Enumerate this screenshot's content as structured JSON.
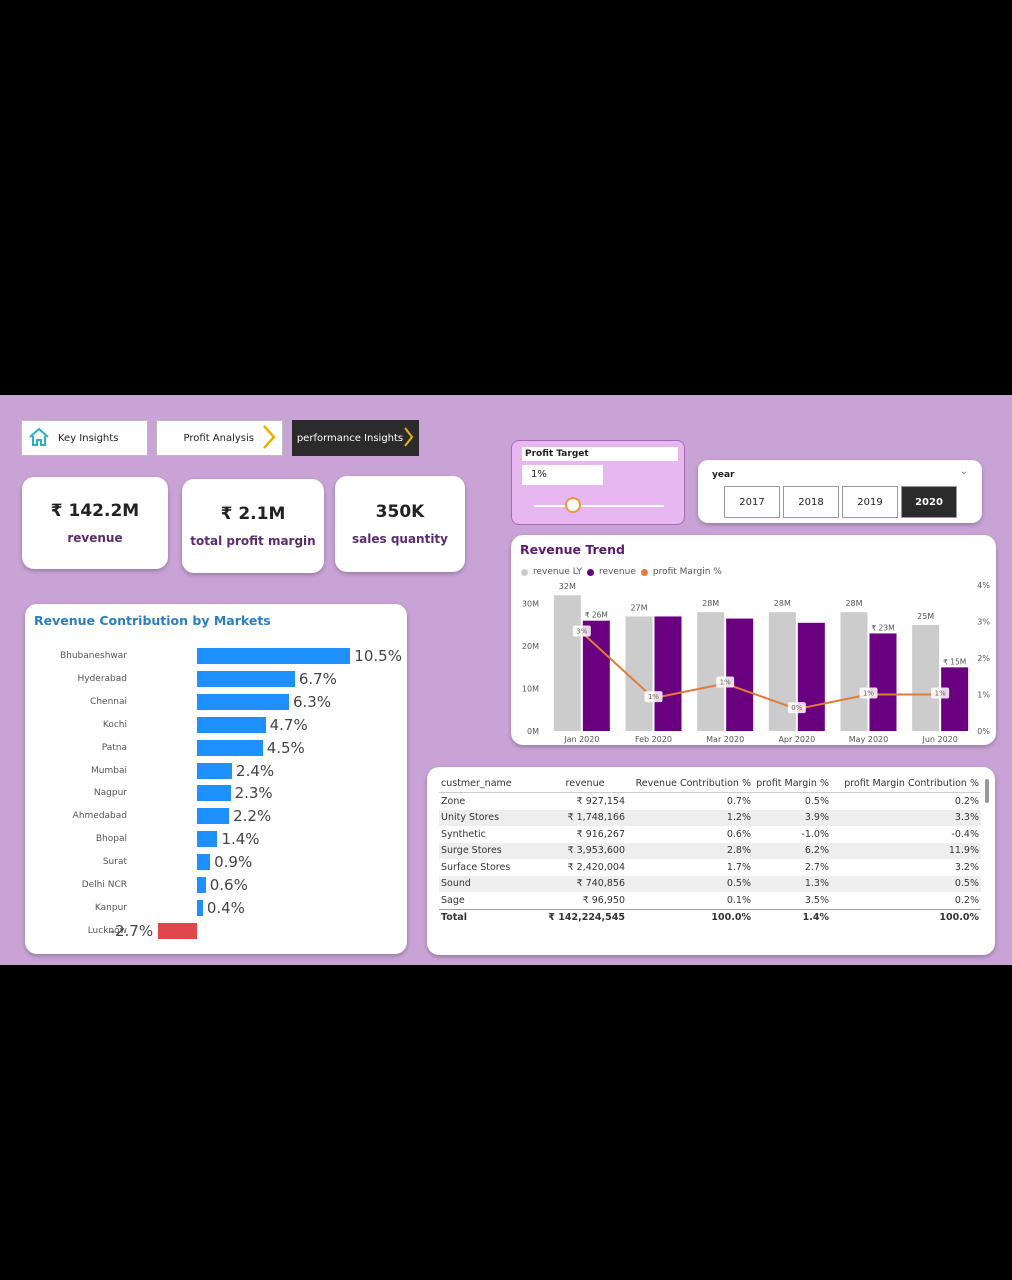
{
  "nav": {
    "key_insights": "Key Insights",
    "profit_analysis": "Profit Analysis",
    "performance_insights": "performance Insights"
  },
  "kpis": [
    {
      "value": "₹ 142.2M",
      "label": "revenue"
    },
    {
      "value": "₹ 2.1M",
      "label": "total profit margin"
    },
    {
      "value": "350K",
      "label": "sales quantity"
    }
  ],
  "profit_target": {
    "title": "Profit Target",
    "value": "1%",
    "slider_fraction": 0.3
  },
  "year_filter": {
    "label": "year",
    "options": [
      "2017",
      "2018",
      "2019",
      "2020"
    ],
    "selected": "2020"
  },
  "markets": {
    "title": "Revenue Contribution by Markets",
    "colors": {
      "positive": "#1e90ff",
      "negative": "#e0474c"
    }
  },
  "trend": {
    "title": "Revenue Trend",
    "legend": [
      "revenue LY",
      "revenue",
      "profit Margin %"
    ],
    "colors": {
      "revenue_ly": "#cccccc",
      "revenue": "#6a0080",
      "profit_margin": "#e07b39"
    }
  },
  "chart_data": [
    {
      "type": "bar",
      "title": "Revenue Contribution by Markets",
      "orientation": "horizontal",
      "categories": [
        "Bhubaneshwar",
        "Hyderabad",
        "Chennai",
        "Kochi",
        "Patna",
        "Mumbai",
        "Nagpur",
        "Ahmedabad",
        "Bhopal",
        "Surat",
        "Delhi NCR",
        "Kanpur",
        "Lucknow"
      ],
      "values": [
        10.5,
        6.7,
        6.3,
        4.7,
        4.5,
        2.4,
        2.3,
        2.2,
        1.4,
        0.9,
        0.6,
        0.4,
        -2.7
      ],
      "labels": [
        "10.5%",
        "6.7%",
        "6.3%",
        "4.7%",
        "4.5%",
        "2.4%",
        "2.3%",
        "2.2%",
        "1.4%",
        "0.9%",
        "0.6%",
        "0.4%",
        "-2.7%"
      ]
    },
    {
      "type": "bar",
      "title": "Revenue Trend",
      "categories": [
        "Jan 2020",
        "Feb 2020",
        "Mar 2020",
        "Apr 2020",
        "May 2020",
        "Jun 2020"
      ],
      "series": [
        {
          "name": "revenue LY",
          "values": [
            32,
            27,
            28,
            28,
            28,
            25
          ],
          "labels": [
            "32M",
            "27M",
            "28M",
            "28M",
            "28M",
            "25M"
          ]
        },
        {
          "name": "revenue",
          "values": [
            26,
            27,
            26.5,
            25.5,
            23,
            15
          ],
          "labels": [
            "₹ 26M",
            "",
            "",
            "",
            "₹ 23M",
            "₹ 15M"
          ]
        },
        {
          "name": "profit Margin %",
          "type": "line",
          "axis": "right",
          "values": [
            2.7,
            0.9,
            1.3,
            0.6,
            1.0,
            1.0
          ],
          "labels": [
            "3%",
            "1%",
            "1%",
            "0%",
            "1%",
            "1%"
          ]
        }
      ],
      "y_left_ticks": [
        "30M",
        "20M",
        "10M",
        "0M"
      ],
      "y_left_range": [
        0,
        33
      ],
      "y_right_ticks": [
        "4%",
        "3%",
        "2%",
        "1%",
        "0%"
      ],
      "y_right_range": [
        0,
        4
      ]
    }
  ],
  "table": {
    "headers": [
      "custmer_name",
      "revenue",
      "Revenue Contribution %",
      "profit Margin %",
      "profit Margin Contribution %"
    ],
    "rows": [
      [
        "Zone",
        "₹ 927,154",
        "0.7%",
        "0.5%",
        "0.2%"
      ],
      [
        "Unity Stores",
        "₹ 1,748,166",
        "1.2%",
        "3.9%",
        "3.3%"
      ],
      [
        "Synthetic",
        "₹ 916,267",
        "0.6%",
        "-1.0%",
        "-0.4%"
      ],
      [
        "Surge Stores",
        "₹ 3,953,600",
        "2.8%",
        "6.2%",
        "11.9%"
      ],
      [
        "Surface Stores",
        "₹ 2,420,004",
        "1.7%",
        "2.7%",
        "3.2%"
      ],
      [
        "Sound",
        "₹ 740,856",
        "0.5%",
        "1.3%",
        "0.5%"
      ],
      [
        "Sage",
        "₹ 96,950",
        "0.1%",
        "3.5%",
        "0.2%"
      ]
    ],
    "total": [
      "Total",
      "₹ 142,224,545",
      "100.0%",
      "1.4%",
      "100.0%"
    ]
  }
}
